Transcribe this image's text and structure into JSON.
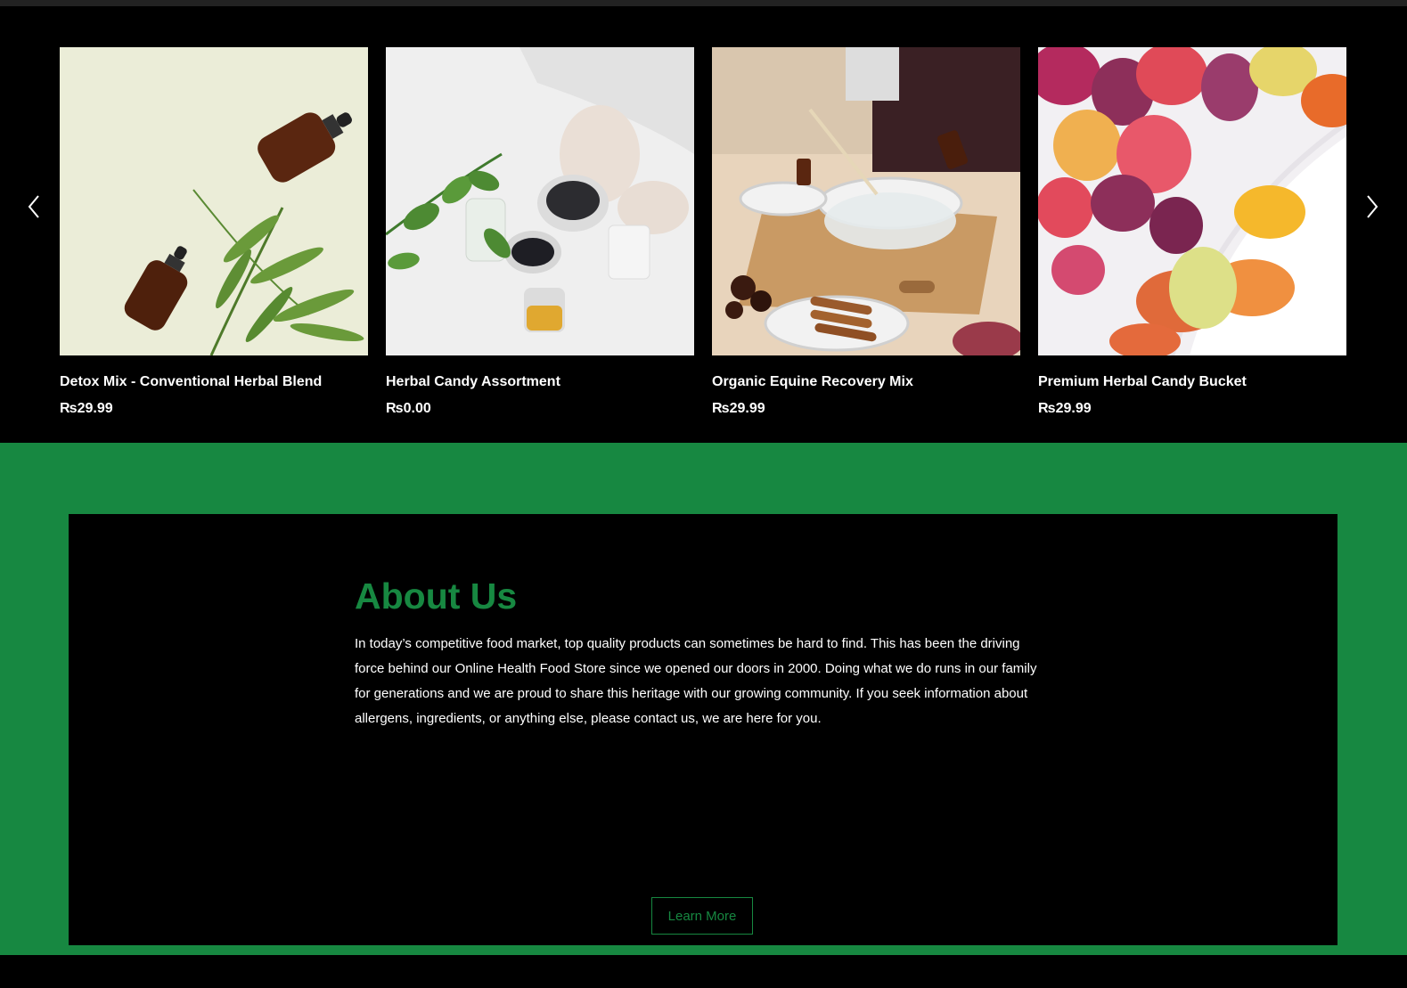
{
  "carousel": {
    "prev_icon": "chevron-left-icon",
    "next_icon": "chevron-right-icon",
    "products": [
      {
        "name": "Detox Mix - Conventional Herbal Blend",
        "price": "₨29.99"
      },
      {
        "name": "Herbal Candy Assortment",
        "price": "₨0.00"
      },
      {
        "name": "Organic Equine Recovery Mix",
        "price": "₨29.99"
      },
      {
        "name": "Premium Herbal Candy Bucket",
        "price": "₨29.99"
      }
    ]
  },
  "about": {
    "title": "About Us",
    "body": "In today’s competitive food market, top quality products can sometimes be hard to find. This has been the driving force behind our Online Health Food Store since we opened our doors in 2000. Doing what we do runs in our family for generations and we are proud to share this heritage with our growing community. If you seek information about allergens, ingredients, or anything else, please contact us, we are here for you.",
    "button_label": "Learn More"
  },
  "colors": {
    "accent": "#178841",
    "background": "#000000",
    "text": "#ffffff"
  }
}
